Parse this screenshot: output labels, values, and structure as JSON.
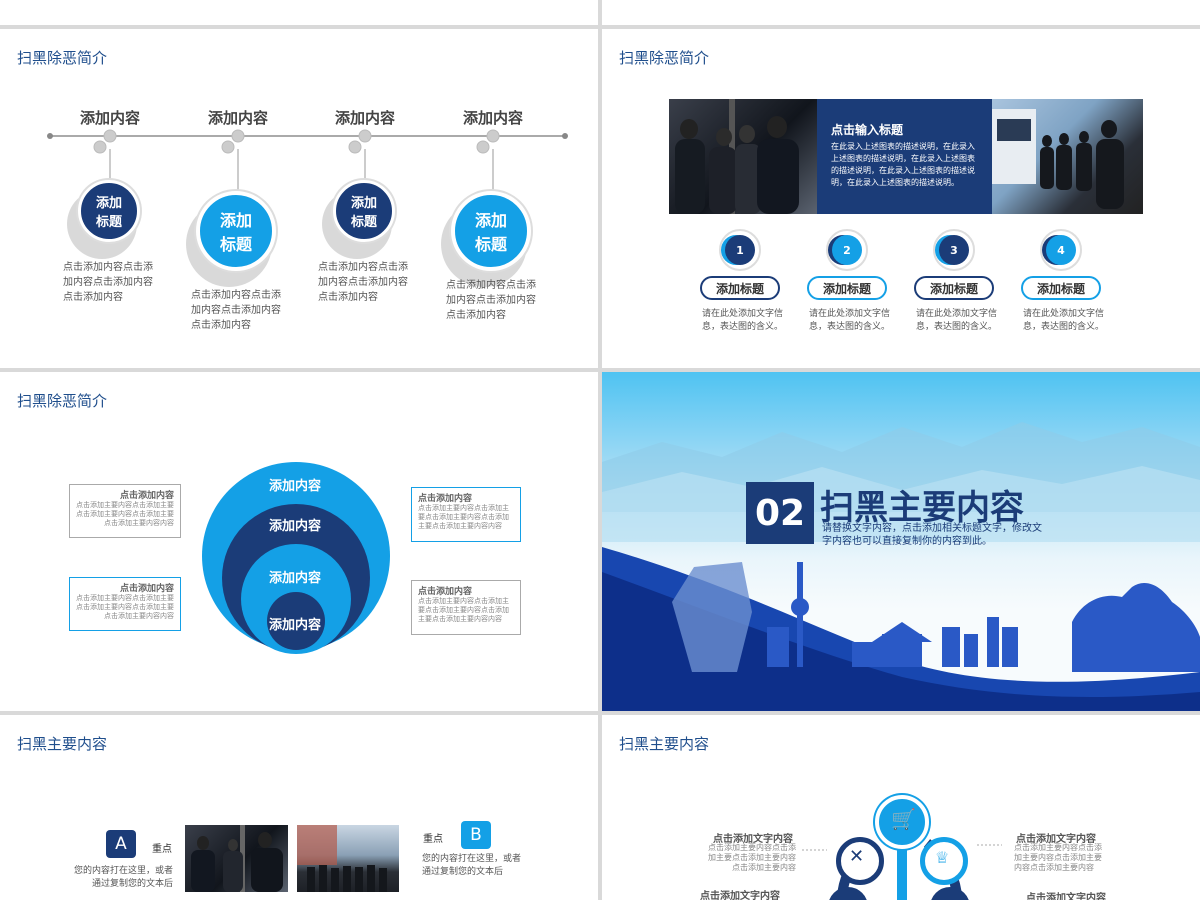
{
  "s1": {
    "title": "扫黑除恶简介",
    "headings": [
      "添加内容",
      "添加内容",
      "添加内容",
      "添加内容"
    ],
    "circles": [
      "添加标题",
      "添加标题",
      "添加标题",
      "添加标题"
    ],
    "texts": [
      "点击添加内容点击添加内容点击添加内容点击添加内容",
      "点击添加内容点击添加内容点击添加内容点击添加内容",
      "点击添加内容点击添加内容点击添加内容点击添加内容",
      "点击添加内容点击添加内容点击添加内容点击添加内容"
    ]
  },
  "s2": {
    "title": "扫黑除恶简介",
    "banner_title": "点击输入标题",
    "banner_text": "在此录入上述图表的描述说明，在此录入上述图表的描述说明，在此录入上述图表的描述说明，在此录入上述图表的描述说明，在此录入上述图表的描述说明。",
    "steps": [
      {
        "num": "1",
        "label": "添加标题",
        "text": "请在此处添加文字信息，表达图的含义。"
      },
      {
        "num": "2",
        "label": "添加标题",
        "text": "请在此处添加文字信息，表达图的含义。"
      },
      {
        "num": "3",
        "label": "添加标题",
        "text": "请在此处添加文字信息，表达图的含义。"
      },
      {
        "num": "4",
        "label": "添加标题",
        "text": "请在此处添加文字信息，表达图的含义。"
      }
    ]
  },
  "s3": {
    "title": "扫黑除恶简介",
    "rings": [
      "添加内容",
      "添加内容",
      "添加内容",
      "添加内容"
    ],
    "boxes": [
      {
        "head": "点击添加内容",
        "body": "点击添加主要内容点击添加主要点击添加主要内容点击添加主要点击添加主要内容内容"
      },
      {
        "head": "点击添加内容",
        "body": "点击添加主要内容点击添加主要点击添加主要内容点击添加主要点击添加主要内容内容"
      },
      {
        "head": "点击添加内容",
        "body": "点击添加主要内容点击添加主要点击添加主要内容点击添加主要点击添加主要内容内容"
      },
      {
        "head": "点击添加内容",
        "body": "点击添加主要内容点击添加主要点击添加主要内容点击添加主要点击添加主要内容内容"
      }
    ]
  },
  "s4": {
    "number": "02",
    "title": "扫黑主要内容",
    "subtitle": "请替换文字内容，点击添加相关标题文字，修改文字内容也可以直接复制你的内容到此。"
  },
  "s5": {
    "title": "扫黑主要内容",
    "a_letter": "A",
    "a_label": "重点",
    "a_text": "您的内容打在这里，或者通过复制您的文本后",
    "b_letter": "B",
    "b_label": "重点",
    "b_text": "您的内容打在这里，或者通过复制您的文本后"
  },
  "s6": {
    "title": "扫黑主要内容",
    "left_head": "点击添加文字内容",
    "left_text": "点击添加主要内容点击添加主要点击添加主要内容点击添加主要内容",
    "left_head2": "点击添加文字内容",
    "right_head": "点击添加文字内容",
    "right_text": "点击添加主要内容点击添加主要内容点击添加主要内容点击添加主要内容",
    "right_head2": "点击添加文字内容"
  },
  "colors": {
    "dark_blue": "#1b3c78",
    "light_blue": "#14a0e6",
    "gray": "#d0d0d0"
  }
}
